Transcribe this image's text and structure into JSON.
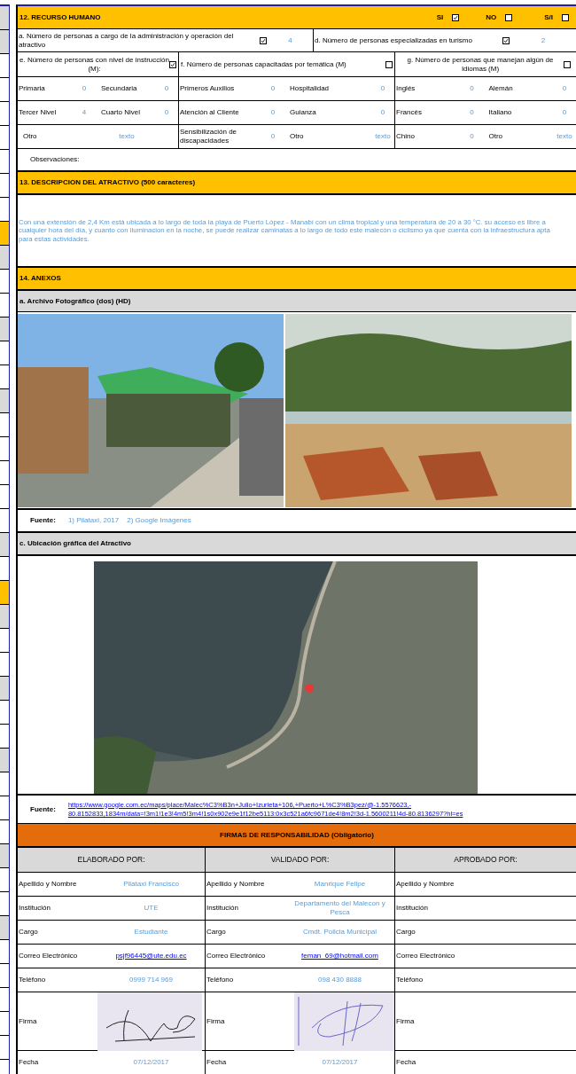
{
  "recurso_humano": {
    "title": "12. RECURSO HUMANO",
    "options": [
      {
        "label": "SI",
        "checked": true
      },
      {
        "label": "NO",
        "checked": false
      },
      {
        "label": "S/I",
        "checked": false
      }
    ],
    "counts": [
      {
        "text": "a. Número de personas a cargo de la administración y operación del atractivo",
        "checked": true,
        "value": "4"
      },
      {
        "text": "d. Número de personas especializadas en turismo",
        "checked": true,
        "value": "2"
      }
    ],
    "groups": [
      {
        "text": "e. Número de personas con nivel de instrucción (M):",
        "checked": true
      },
      {
        "text": "f. Número de personas capacitadas por temática (M)",
        "checked": false
      },
      {
        "text": "g. Número de personas que manejan algún de Idiomas (M)",
        "checked": false
      }
    ],
    "rows": [
      [
        [
          {
            "label": "Primaria",
            "value": "0"
          },
          {
            "label": "Secundaria",
            "value": "0"
          }
        ],
        [
          {
            "label": "Primeros Auxilios",
            "value": "0"
          },
          {
            "label": "Hospitalidad",
            "value": "0"
          }
        ],
        [
          {
            "label": "Inglés",
            "value": "0"
          },
          {
            "label": "Alemán",
            "value": "0"
          }
        ]
      ],
      [
        [
          {
            "label": "Tercer Nivel",
            "value": "4"
          },
          {
            "label": "Cuarto Nivel",
            "value": "0"
          }
        ],
        [
          {
            "label": "Atención al Cliente",
            "value": "0"
          },
          {
            "label": "Guianza",
            "value": "0"
          }
        ],
        [
          {
            "label": "Francés",
            "value": "0"
          },
          {
            "label": "Italiano",
            "value": "0"
          }
        ]
      ],
      [
        [
          {
            "label": "Otro",
            "value": "texto"
          }
        ],
        [
          {
            "label": "Sensibilización de discapacidades",
            "value": "0"
          },
          {
            "label": "Otro",
            "value": "texto"
          }
        ],
        [
          {
            "label": "Chino",
            "value": "0"
          },
          {
            "label": "Otro",
            "value": "texto"
          }
        ]
      ]
    ],
    "observaciones": "Observaciones:"
  },
  "descripcion": {
    "title": "13. DESCRIPCION DEL ATRACTIVO (500 caracteres)",
    "lines": [
      "Con una extensión de 2,4 Km está ubicada a lo largo de toda la playa de Puerto López - Manabí con un clima tropical y una temperatura de 20 a 30 °C. su acceso es libre a",
      "cualquier hora del día, y cuanto con iluminacion en la noche, se puede realizar caminatas a lo largo de todo este malecón o ciclismo ya que cuenta con la infraestructura apta",
      "para estas actividades."
    ]
  },
  "anexos": {
    "title": "14. ANEXOS",
    "archivo": {
      "title": "a. Archivo Fotográfico (dos) (HD)",
      "source_label": "Fuente:",
      "sources": [
        "1) Pilataxi, 2017",
        "2) Google Imágenes"
      ]
    },
    "ubicacion": {
      "title": "c. Ubicación gráfica del Atractivo",
      "source_label": "Fuente:",
      "link_lines": [
        "https://www.google.com.ec/maps/place/Malec%C3%B3n+Julio+Izurieta+106,+Puerto+L%C3%B3pez/@-1.5576623,-",
        "80.8152833,1834m/data=!3m1!1e3!4m5!3m4!1s0x902e9e1f12be5113:0x3c521a6fc9671de4!8m2!3d-1.5600211!4d-80.8136297?hl=es"
      ]
    }
  },
  "firmas": {
    "title": "FIRMAS DE RESPONSABILIDAD (Obligatorio)",
    "columns": [
      {
        "header": "ELABORADO POR:",
        "rows": [
          {
            "label": "Apellido y Nombre",
            "kind": "text",
            "value": "Pilataxi Francisco"
          },
          {
            "label": "Institución",
            "kind": "text",
            "value": "UTE"
          },
          {
            "label": "Cargo",
            "kind": "text",
            "value": "Estudiante"
          },
          {
            "label": "Correo Electrónico",
            "kind": "link",
            "value": "psjf96445@ute.edu.ec"
          },
          {
            "label": "Teléfono",
            "kind": "text",
            "value": "0999 714 969"
          },
          {
            "label": "Firma",
            "kind": "signature"
          },
          {
            "label": "Fecha",
            "kind": "text",
            "value": "07/12/2017"
          }
        ]
      },
      {
        "header": "VALIDADO  POR:",
        "rows": [
          {
            "label": "Apellido y Nombre",
            "kind": "text",
            "value": "Manrique Felipe"
          },
          {
            "label": "Institución",
            "kind": "text",
            "value": "Departamento del Malecon y Pesca"
          },
          {
            "label": "Cargo",
            "kind": "text",
            "value": "Cmdt. Policia Municipal"
          },
          {
            "label": "Correo Electrónico",
            "kind": "link",
            "value": "feman_69@hotmail.com"
          },
          {
            "label": "Teléfono",
            "kind": "text",
            "value": "098 430 8888"
          },
          {
            "label": "Firma",
            "kind": "signature"
          },
          {
            "label": "Fecha",
            "kind": "text",
            "value": "07/12/2017"
          }
        ]
      },
      {
        "header": "APROBADO POR:",
        "rows": [
          {
            "label": "Apellido y Nombre",
            "kind": "empty"
          },
          {
            "label": "Institución",
            "kind": "empty"
          },
          {
            "label": "Cargo",
            "kind": "empty"
          },
          {
            "label": "Correo Electrónico",
            "kind": "empty"
          },
          {
            "label": "Teléfono",
            "kind": "empty"
          },
          {
            "label": "Firma",
            "kind": "empty"
          },
          {
            "label": "Fecha",
            "kind": "empty"
          }
        ]
      }
    ]
  }
}
